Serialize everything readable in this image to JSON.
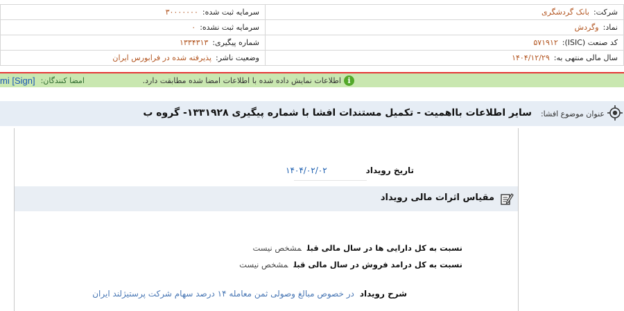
{
  "info": {
    "company_label": "شرکت:",
    "company_value": "بانک گردشگری",
    "registered_capital_label": "سرمایه ثبت شده:",
    "registered_capital_value": "۳۰۰۰۰۰۰۰",
    "symbol_label": "نماد:",
    "symbol_value": "وگردش",
    "unregistered_capital_label": "سرمایه ثبت نشده:",
    "unregistered_capital_value": "۰",
    "isic_label": "کد صنعت (ISIC):",
    "isic_value": "۵۷۱۹۱۲",
    "tracking_label": "شماره پیگیری:",
    "tracking_value": "۱۳۳۴۳۱۳",
    "fiscal_label": "سال مالی منتهی به:",
    "fiscal_value": "۱۴۰۴/۱۲/۲۹",
    "publisher_label": "وضعیت ناشر:",
    "publisher_value": "پذیرفته شده در فرابورس ایران"
  },
  "sign_bar": {
    "signers_label": "امضا کنندگان:",
    "signers_value": "mi [Sign]",
    "message": "اطلاعات نمایش داده شده با اطلاعات امضا شده مطابقت دارد."
  },
  "subject": {
    "label": "عنوان موضوع افشا:",
    "title": "سایر اطلاعات بااهمیت - تکمیل مستندات افشا با شماره پیگیری ۱۳۳۱۹۲۸- گروه ب"
  },
  "event": {
    "date_label": "تاریخ رویداد",
    "date_value": "۱۴۰۴/۰۲/۰۲",
    "section_title": "مقیاس اثرات مالی رویداد",
    "ratio_assets_label": "نسبت به کل دارایی ها در سال مالی قبل",
    "ratio_assets_value": "مشخص نیست",
    "ratio_revenue_label": "نسبت به کل درامد فروش در سال مالی قبل",
    "ratio_revenue_value": "مشخص نیست",
    "desc_label": "شرح رویداد",
    "desc_value": "در خصوص مبالغ وصولی ثمن معامله ۱۴ درصد سهام شرکت پرستیژلند ایران"
  },
  "icons": {
    "ok": "check-info-icon",
    "target": "target-icon",
    "edit": "edit-note-icon"
  }
}
